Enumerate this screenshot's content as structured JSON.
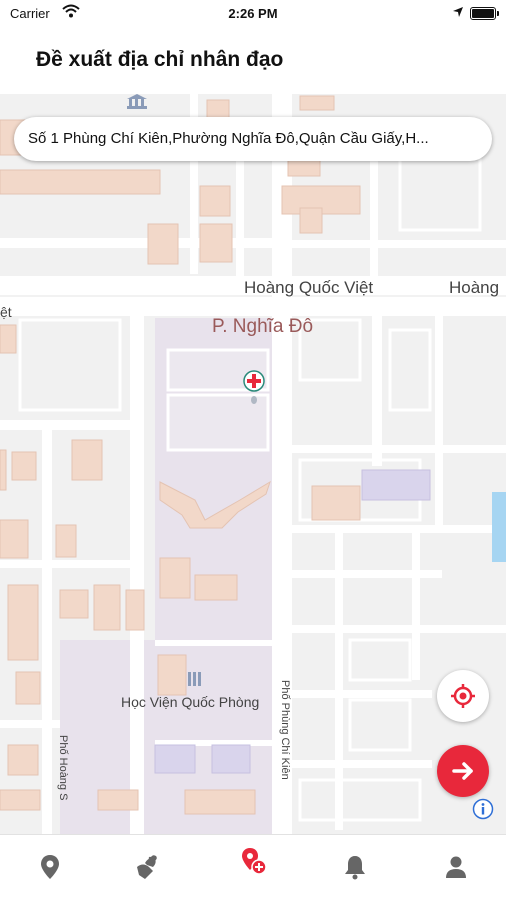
{
  "status_bar": {
    "carrier": "Carrier",
    "time": "2:26 PM"
  },
  "header": {
    "title": "Đề xuất địa chỉ nhân đạo"
  },
  "search": {
    "address": "Số 1 Phùng Chí Kiên,Phường Nghĩa Đô,Quận Cầu Giấy,H..."
  },
  "map": {
    "labels": {
      "road_main": "Hoàng Quốc Việt",
      "road_main_right": "Hoàng",
      "road_main_left": "ệt",
      "ward": "P. Nghĩa Đô",
      "academy": "Học Viện Quốc Phòng",
      "street_right": "Phố Phùng Chí Kiên",
      "street_left": "Phố Hoàng S"
    },
    "marker": "red-cross-marker-icon"
  },
  "buttons": {
    "locate": "crosshair-locate-icon",
    "next": "arrow-right-icon",
    "info": "info-icon"
  },
  "tabbar": {
    "items": [
      {
        "name": "location-pin-icon",
        "active": false
      },
      {
        "name": "hands-heart-icon",
        "active": false
      },
      {
        "name": "pin-plus-icon",
        "active": true
      },
      {
        "name": "bell-icon",
        "active": false
      },
      {
        "name": "user-icon",
        "active": false
      }
    ]
  },
  "colors": {
    "accent": "#e8283b",
    "inactive": "#666666",
    "map_bg": "#f1f1f1",
    "building": "#f2d8c9",
    "campus": "#e8e2ec"
  }
}
